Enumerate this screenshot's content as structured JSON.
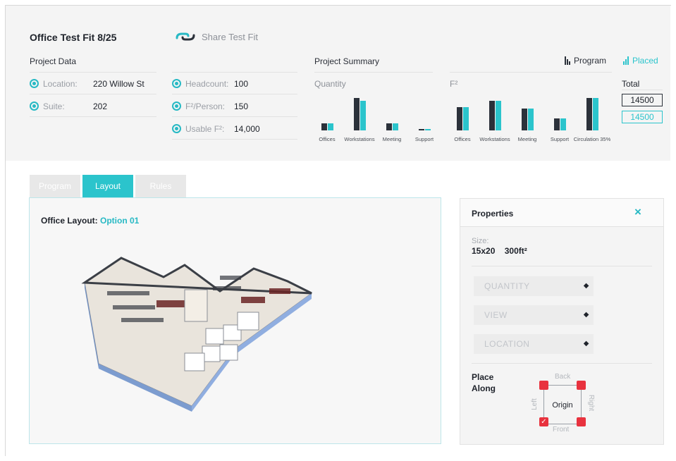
{
  "header": {
    "title": "Office Test Fit 8/25",
    "share_label": "Share Test Fit"
  },
  "project_data": {
    "label": "Project Data",
    "left": [
      {
        "label": "Location:",
        "value": "220 Willow St"
      },
      {
        "label": "Suite:",
        "value": "202"
      }
    ],
    "right": [
      {
        "label": "Headcount:",
        "value": "100"
      },
      {
        "label": "F²/Person:",
        "value": "150"
      },
      {
        "label": "Usable F²:",
        "value": "14,000"
      }
    ]
  },
  "summary": {
    "label": "Project Summary",
    "quantity_label": "Quantity",
    "area_label": "F²",
    "legend_program": "Program",
    "legend_placed": "Placed",
    "total_label": "Total",
    "total_program": "14500",
    "total_placed": "14500",
    "colors": {
      "program": "#2b313a",
      "placed": "#2bc4cc"
    }
  },
  "chart_data": [
    {
      "type": "bar",
      "title": "Quantity",
      "categories": [
        "Offices",
        "Workstations",
        "Meeting",
        "Support"
      ],
      "series": [
        {
          "name": "Program",
          "values": [
            10,
            44,
            10,
            2
          ]
        },
        {
          "name": "Placed",
          "values": [
            10,
            40,
            10,
            2
          ]
        }
      ]
    },
    {
      "type": "bar",
      "title": "F²",
      "categories": [
        "Offices",
        "Workstations",
        "Meeting",
        "Support",
        "Circulation 35%"
      ],
      "series": [
        {
          "name": "Program",
          "values": [
            35,
            45,
            33,
            18,
            49
          ]
        },
        {
          "name": "Placed",
          "values": [
            35,
            45,
            33,
            18,
            49
          ]
        }
      ]
    }
  ],
  "tabs": [
    {
      "label": "Program",
      "selected": false
    },
    {
      "label": "Layout",
      "selected": true
    },
    {
      "label": "Rules",
      "selected": false
    }
  ],
  "layout": {
    "title": "Office Layout:",
    "option": "Option 01"
  },
  "properties": {
    "title": "Properties",
    "close_icon": "×",
    "size_label": "Size:",
    "size_value": "15x20",
    "area_value": "300ft²",
    "selects": [
      "QUANTITY",
      "VIEW",
      "LOCATION"
    ],
    "select_arrow": "◆",
    "place_along": "Place Along",
    "origin_label": "Origin",
    "back": "Back",
    "front": "Front",
    "left": "Left",
    "right": "Right"
  }
}
